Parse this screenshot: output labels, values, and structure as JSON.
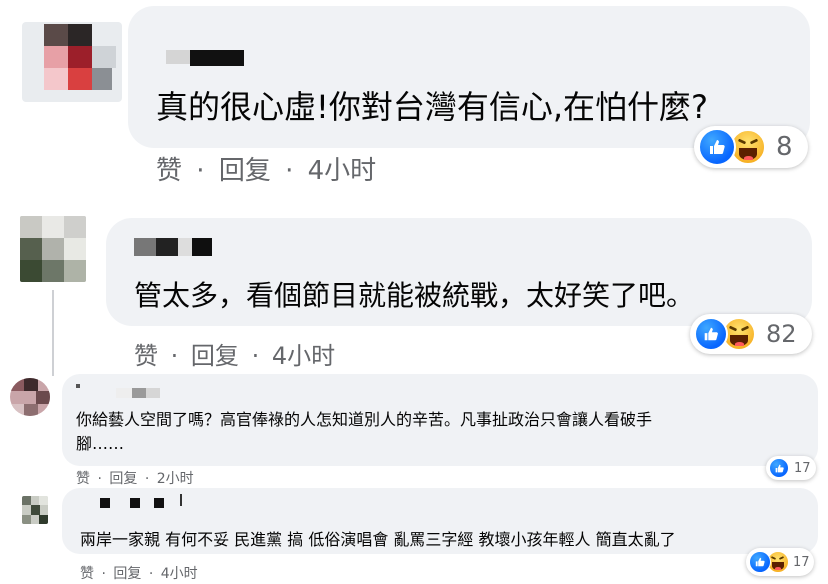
{
  "comments": [
    {
      "text": "真的很心虛!你對台灣有信心,在怕什麼?",
      "reaction_count": "8",
      "actions": {
        "like": "赞",
        "reply": "回复",
        "time": "4小时",
        "sep": "·"
      }
    },
    {
      "text": "管太多，看個節目就能被統戰，太好笑了吧。",
      "reaction_count": "82",
      "actions": {
        "like": "赞",
        "reply": "回复",
        "time": "4小时",
        "sep": "·"
      }
    },
    {
      "text_line1": "你給藝人空間了嗎？高官俸祿的人怎知道別人的辛苦。凡事扯政治只會讓人看破手",
      "text_line2": "腳……",
      "reaction_count": "17",
      "actions": {
        "like": "赞",
        "reply": "回复",
        "time": "2小时",
        "sep": "·"
      }
    },
    {
      "text": "兩岸一家親 有何不妥 民進黨 搞 低俗演唱會 亂罵三字經 教壞小孩年輕人 簡直太亂了",
      "reaction_count": "17",
      "actions": {
        "like": "赞",
        "reply": "回复",
        "time": "4小时",
        "sep": "·"
      }
    }
  ],
  "icons": {
    "like": "like-reaction-icon",
    "haha": "haha-reaction-icon"
  },
  "colors": {
    "bubble": "#f0f2f5",
    "meta": "#65676b",
    "like_blue": "#0866ff",
    "haha_yellow": "#f7b125"
  }
}
